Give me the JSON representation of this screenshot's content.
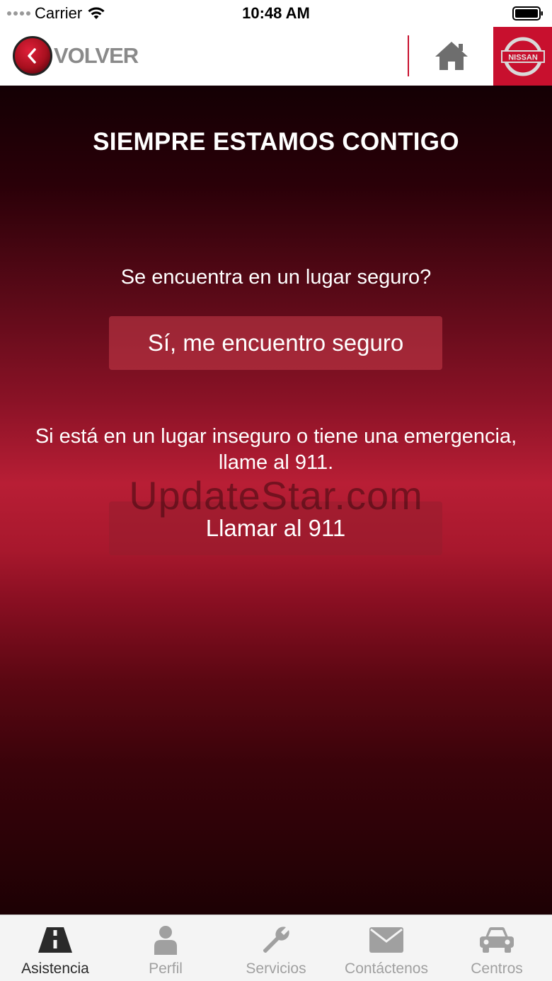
{
  "status_bar": {
    "carrier": "Carrier",
    "time": "10:48 AM",
    "icons": [
      "signal-dots-icon",
      "wifi-icon",
      "battery-icon"
    ]
  },
  "nav": {
    "back_label": "VOLVER",
    "back_icon": "chevron-left-icon",
    "home_icon": "home-icon",
    "brand_logo_text": "NISSAN",
    "brand_color": "#c8102e"
  },
  "main": {
    "headline": "SIEMPRE ESTAMOS CONTIGO",
    "question": "Se encuentra en un lugar seguro?",
    "safe_button": "Sí, me encuentro seguro",
    "emergency_text": "Si está en un lugar inseguro o tiene una emergencia, llame al 911.",
    "call_button": "Llamar al 911",
    "watermark": "UpdateStar.com"
  },
  "tabs": [
    {
      "label": "Asistencia",
      "icon": "road-icon",
      "active": true
    },
    {
      "label": "Perfil",
      "icon": "person-icon",
      "active": false
    },
    {
      "label": "Servicios",
      "icon": "wrench-icon",
      "active": false
    },
    {
      "label": "Contáctenos",
      "icon": "envelope-icon",
      "active": false
    },
    {
      "label": "Centros",
      "icon": "car-icon",
      "active": false
    }
  ]
}
